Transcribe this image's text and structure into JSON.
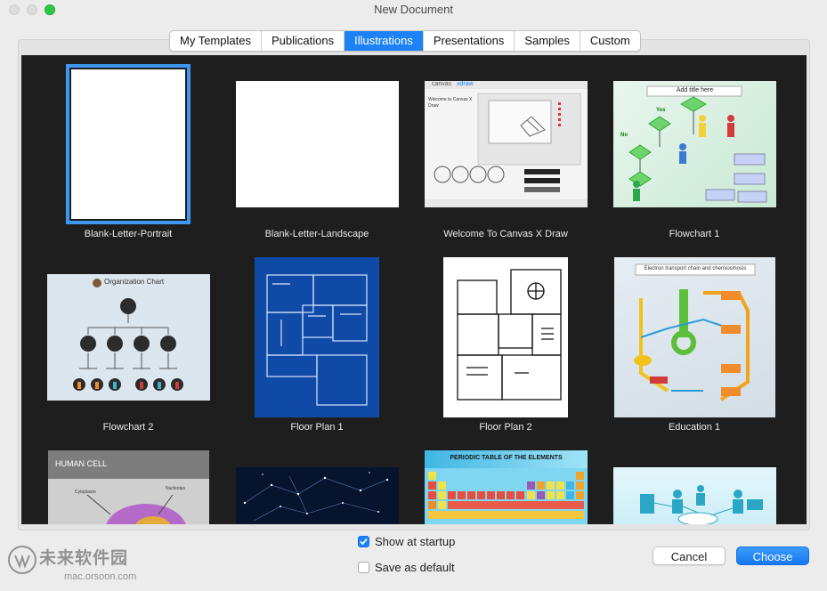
{
  "window": {
    "title": "New Document"
  },
  "tabs": [
    {
      "label": "My Templates",
      "active": false
    },
    {
      "label": "Publications",
      "active": false
    },
    {
      "label": "Illustrations",
      "active": true
    },
    {
      "label": "Presentations",
      "active": false
    },
    {
      "label": "Samples",
      "active": false
    },
    {
      "label": "Custom",
      "active": false
    }
  ],
  "templates": [
    {
      "name": "Blank-Letter-Portrait",
      "selected": true
    },
    {
      "name": "Blank-Letter-Landscape"
    },
    {
      "name": "Welcome To Canvas X Draw"
    },
    {
      "name": "Flowchart 1"
    },
    {
      "name": "Flowchart 2"
    },
    {
      "name": "Floor Plan 1"
    },
    {
      "name": "Floor Plan 2"
    },
    {
      "name": "Education 1"
    },
    {
      "name": ""
    },
    {
      "name": ""
    },
    {
      "name": ""
    },
    {
      "name": ""
    }
  ],
  "thumb_text": {
    "canvas_logo": "canvas",
    "canvas_logo2": "xdraw",
    "welcome": "Welcome to Canvas X Draw",
    "flow1_title": "Add title here",
    "flow1_yes": "Yes",
    "flow1_no": "No",
    "org_title": "Organization Chart",
    "edu_title": "Electron transport chain and chemiosmosis",
    "human_cell": "HUMAN CELL",
    "cell_label1": "Cytoplasm",
    "cell_label2": "Nucleolus",
    "periodic": "PERIODIC TABLE OF THE ELEMENTS"
  },
  "options": {
    "show_at_startup": {
      "label": "Show at startup",
      "checked": true
    },
    "save_as_default": {
      "label": "Save as default",
      "checked": false
    }
  },
  "buttons": {
    "cancel": "Cancel",
    "choose": "Choose"
  },
  "watermark": {
    "text": "未来软件园",
    "url": "mac.orsoon.com"
  }
}
